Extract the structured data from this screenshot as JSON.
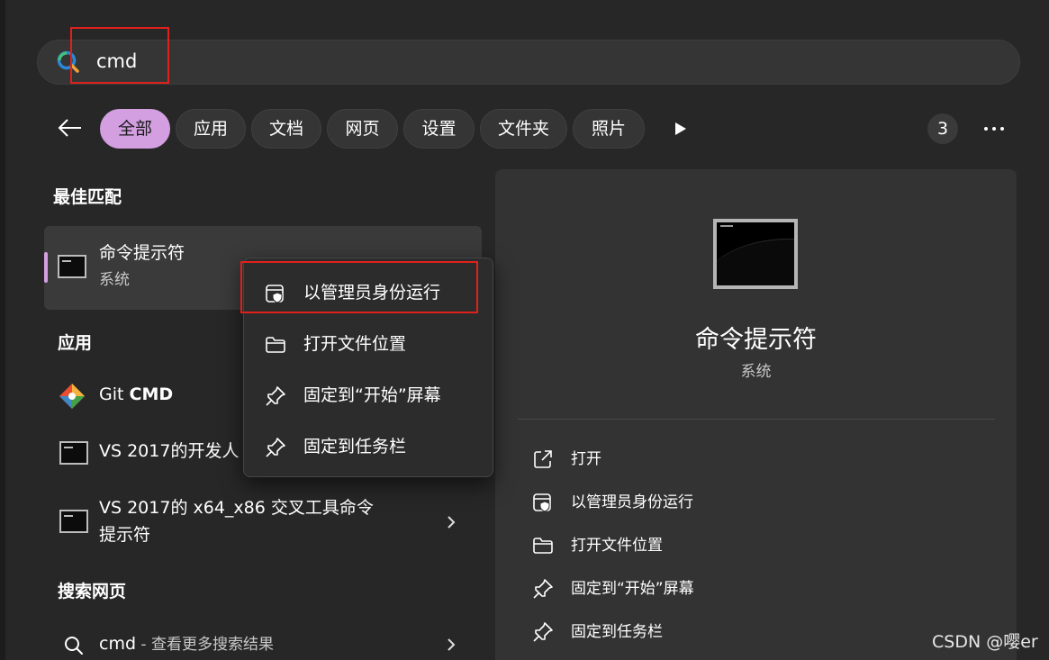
{
  "search": {
    "query": "cmd"
  },
  "filters": [
    {
      "label": "全部",
      "active": true
    },
    {
      "label": "应用",
      "active": false
    },
    {
      "label": "文档",
      "active": false
    },
    {
      "label": "网页",
      "active": false
    },
    {
      "label": "设置",
      "active": false
    },
    {
      "label": "文件夹",
      "active": false
    },
    {
      "label": "照片",
      "active": false
    }
  ],
  "result_count": "3",
  "sections": {
    "best_match": "最佳匹配",
    "apps": "应用",
    "web": "搜索网页"
  },
  "best_match": {
    "title": "命令提示符",
    "subtitle": "系统"
  },
  "apps": [
    {
      "title_prefix": "Git ",
      "title_bold": "CMD",
      "icon": "git-icon"
    },
    {
      "title": "VS 2017的开发人",
      "icon": "cmd-icon"
    },
    {
      "title_line1": "VS 2017的 x64_x86 交叉工具命令",
      "title_line2": "提示符",
      "icon": "cmd-icon"
    }
  ],
  "web_search": {
    "query": "cmd",
    "suffix": " - 查看更多搜索结果"
  },
  "context_menu": [
    {
      "label": "以管理员身份运行",
      "icon": "shield-icon"
    },
    {
      "label": "打开文件位置",
      "icon": "folder-icon"
    },
    {
      "label": "固定到“开始”屏幕",
      "icon": "pin-icon"
    },
    {
      "label": "固定到任务栏",
      "icon": "pin-icon"
    }
  ],
  "details": {
    "title": "命令提示符",
    "subtitle": "系统",
    "actions": [
      {
        "label": "打开",
        "icon": "open-external-icon"
      },
      {
        "label": "以管理员身份运行",
        "icon": "shield-icon"
      },
      {
        "label": "打开文件位置",
        "icon": "folder-icon"
      },
      {
        "label": "固定到“开始”屏幕",
        "icon": "pin-icon"
      },
      {
        "label": "固定到任务栏",
        "icon": "pin-icon"
      }
    ]
  },
  "watermark": "CSDN @嘤er",
  "colors": {
    "accent": "#d39fe1",
    "highlight_box": "#e0211b",
    "panel": "#272727"
  }
}
